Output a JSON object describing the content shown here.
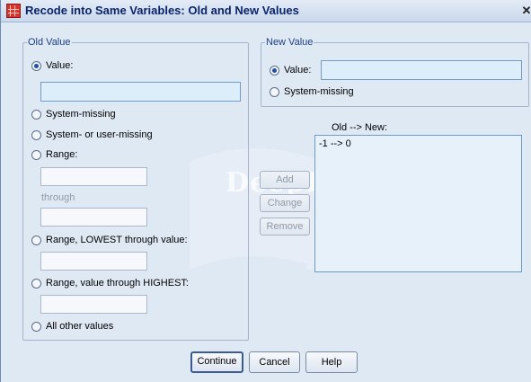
{
  "window": {
    "title": "Recode into Same Variables: Old and New Values",
    "close_glyph": "✕"
  },
  "watermark": {
    "text": "DeepBooks"
  },
  "old_value": {
    "legend": "Old Value",
    "value_label": "Value:",
    "value_input": "",
    "system_missing_label": "System-missing",
    "system_user_missing_label": "System- or user-missing",
    "range_label": "Range:",
    "range_from": "",
    "through_label": "through",
    "range_to": "",
    "range_lowest_label": "Range, LOWEST through value:",
    "range_lowest_value": "",
    "range_highest_label": "Range, value through HIGHEST:",
    "range_highest_value": "",
    "all_other_label": "All other values",
    "selected": "value"
  },
  "new_value": {
    "legend": "New Value",
    "value_label": "Value:",
    "value_input": "",
    "system_missing_label": "System-missing",
    "selected": "value"
  },
  "mapping": {
    "header": "Old --> New:",
    "items": [
      "-1 --> 0"
    ]
  },
  "buttons": {
    "add": "Add",
    "change": "Change",
    "remove": "Remove",
    "continue": "Continue",
    "cancel": "Cancel",
    "help": "Help"
  },
  "colors": {
    "title_text": "#0a246a",
    "legend_text": "#1d3f86",
    "dialog_bg": "#dfe9f4"
  }
}
